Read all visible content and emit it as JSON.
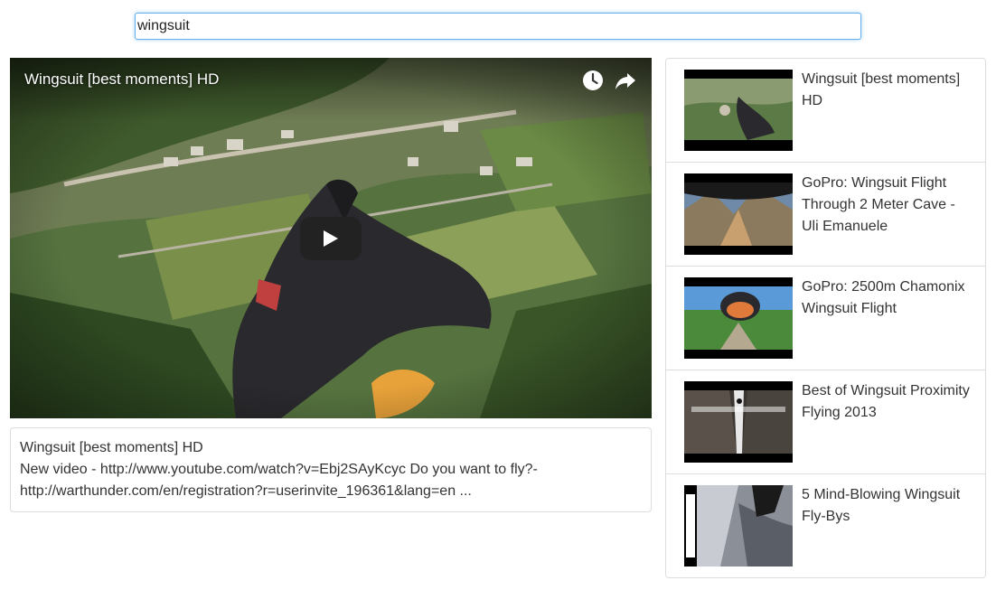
{
  "search": {
    "value": "wingsuit"
  },
  "player": {
    "title": "Wingsuit [best moments] HD",
    "watch_later_icon": "clock-icon",
    "share_icon": "share-icon",
    "play_icon": "play-icon"
  },
  "description": {
    "title": "Wingsuit [best moments] HD",
    "text": "New video - http://www.youtube.com/watch?v=Ebj2SAyKcyc Do you want to fly?- http://warthunder.com/en/registration?r=userinvite_196361&lang=en ..."
  },
  "playlist": {
    "items": [
      {
        "title": "Wingsuit [best moments] HD"
      },
      {
        "title": "GoPro: Wingsuit Flight Through 2 Meter Cave - Uli Emanuele"
      },
      {
        "title": "GoPro: 2500m Chamonix Wingsuit Flight"
      },
      {
        "title": "Best of Wingsuit Proximity Flying 2013"
      },
      {
        "title": "5 Mind-Blowing Wingsuit Fly-Bys"
      }
    ]
  },
  "colors": {
    "focus_border": "#66afe9",
    "panel_border": "#dddddd",
    "text": "#333333"
  }
}
